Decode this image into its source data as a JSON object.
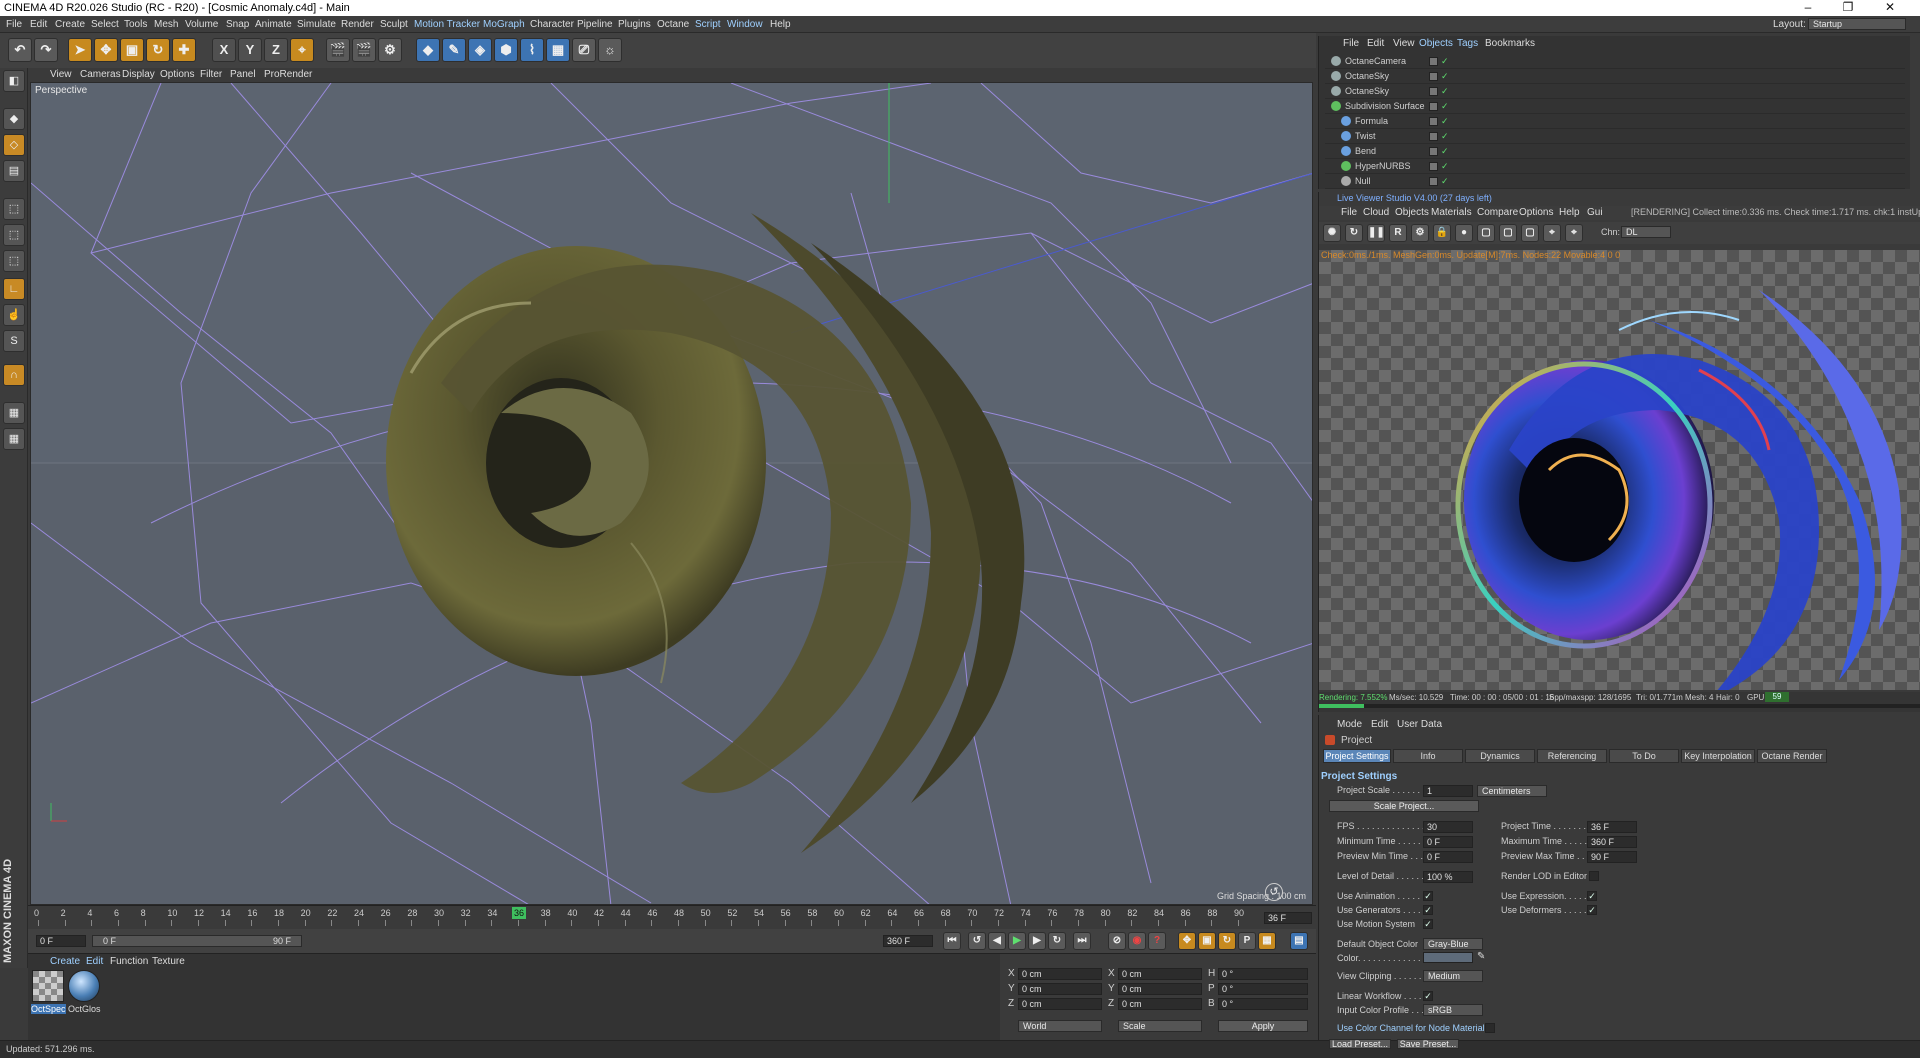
{
  "window": {
    "title": "CINEMA 4D R20.026 Studio (RC - R20) - [Cosmic Anomaly.c4d] - Main",
    "minimize": "–",
    "maximize": "❐",
    "close": "✕"
  },
  "menu": {
    "items": [
      "File",
      "Edit",
      "Create",
      "Select",
      "Tools",
      "Mesh",
      "Volume",
      "Snap",
      "Animate",
      "Simulate",
      "Render",
      "Sculpt",
      "Motion Tracker",
      "MoGraph",
      "Character",
      "Pipeline",
      "Plugins",
      "Octane",
      "Script",
      "Window",
      "Help"
    ],
    "layout_label": "Layout:",
    "layout_value": "Startup"
  },
  "toolbar": {
    "axis_x": "X",
    "axis_y": "Y",
    "axis_z": "Z"
  },
  "viewport": {
    "menu": [
      "View",
      "Cameras",
      "Display",
      "Options",
      "Filter",
      "Panel",
      "ProRender"
    ],
    "label": "Perspective",
    "grid_spacing": "Grid Spacing : 100 cm"
  },
  "timeline": {
    "ticks": [
      "0",
      "2",
      "4",
      "6",
      "8",
      "10",
      "12",
      "14",
      "16",
      "18",
      "20",
      "22",
      "24",
      "26",
      "28",
      "30",
      "32",
      "34",
      "36",
      "38",
      "40",
      "42",
      "44",
      "46",
      "48",
      "50",
      "52",
      "54",
      "56",
      "58",
      "60",
      "62",
      "64",
      "66",
      "68",
      "70",
      "72",
      "74",
      "76",
      "78",
      "80",
      "82",
      "84",
      "86",
      "88",
      "90"
    ],
    "current_frame": "36",
    "end_field": "36 F"
  },
  "playbar": {
    "start": "0 F",
    "min": "0 F",
    "max": "90 F",
    "end": "360 F"
  },
  "materials": {
    "menu": [
      "Create",
      "Edit",
      "Function",
      "Texture"
    ],
    "items": [
      "OctSpec",
      "OctGlos"
    ]
  },
  "coords": {
    "rows": [
      {
        "a": "X",
        "av": "0 cm",
        "b": "X",
        "bv": "0 cm",
        "c": "H",
        "cv": "0 °"
      },
      {
        "a": "Y",
        "av": "0 cm",
        "b": "Y",
        "bv": "0 cm",
        "c": "P",
        "cv": "0 °"
      },
      {
        "a": "Z",
        "av": "0 cm",
        "b": "Z",
        "bv": "0 cm",
        "c": "B",
        "cv": "0 °"
      }
    ],
    "world": "World",
    "scale": "Scale",
    "apply": "Apply"
  },
  "status": {
    "text": "Updated: 571.296 ms."
  },
  "objects": {
    "menu": [
      "File",
      "Edit",
      "View",
      "Objects",
      "Tags",
      "Bookmarks"
    ],
    "rows": [
      {
        "name": "OctaneCamera",
        "indent": 0,
        "color": "#9aa"
      },
      {
        "name": "OctaneSky",
        "indent": 0,
        "color": "#9aa"
      },
      {
        "name": "OctaneSky",
        "indent": 0,
        "color": "#9aa"
      },
      {
        "name": "Subdivision Surface",
        "indent": 0,
        "color": "#5fbf5f"
      },
      {
        "name": "Formula",
        "indent": 1,
        "color": "#6aa0e0"
      },
      {
        "name": "Twist",
        "indent": 1,
        "color": "#6aa0e0"
      },
      {
        "name": "Bend",
        "indent": 1,
        "color": "#6aa0e0"
      },
      {
        "name": "HyperNURBS",
        "indent": 1,
        "color": "#5fbf5f"
      },
      {
        "name": "Null",
        "indent": 1,
        "color": "#aaa"
      }
    ]
  },
  "liveviewer": {
    "title": "Live Viewer Studio V4.00 (27 days left)",
    "menu": [
      "File",
      "Cloud",
      "Objects",
      "Materials",
      "Compare",
      "Options",
      "Help",
      "Gui"
    ],
    "render_status": "[RENDERING] Collect time:0.336 ms.  Check time:1.717 ms.  chk:1  instUpd:0",
    "chn_label": "Chn:",
    "chn_value": "DL",
    "info": "Check:0ms./1ms. MeshGen:0ms. Update[M]:7ms. Nodes:22 Movable:4 0 0",
    "footer": {
      "rendering": "Rendering: 7.552%",
      "mssec": "Ms/sec: 10.529",
      "time": "Time: 00 : 00 : 05/00 : 01 : 16",
      "spp": "Spp/maxspp: 128/1695",
      "tri": "Tri: 0/1.771m",
      "mesh": "Mesh: 4",
      "hair": "Hair: 0",
      "gpu": "GPU:",
      "gpu_val": "59"
    },
    "progress": 0.0755
  },
  "attributes": {
    "menu": [
      "Mode",
      "Edit",
      "User Data"
    ],
    "object": "Project",
    "tabs": [
      "Project Settings",
      "Info",
      "Dynamics",
      "Referencing",
      "To Do",
      "Key Interpolation",
      "Octane Render"
    ],
    "section": "Project Settings",
    "project_scale_label": "Project Scale . . . . . .",
    "project_scale_value": "1",
    "project_scale_unit": "Centimeters",
    "scale_project_btn": "Scale Project...",
    "fps_label": "FPS . . . . . . . . . . . . . . .",
    "fps": "30",
    "project_time_label": "Project Time . . . . . . .",
    "project_time": "36 F",
    "min_time_label": "Minimum Time . . . . . .",
    "min_time": "0 F",
    "max_time_label": "Maximum Time . . . . . .",
    "max_time": "360 F",
    "prev_min_label": "Preview Min Time . . . .",
    "prev_min": "0 F",
    "prev_max_label": "Preview Max Time . . .",
    "prev_max": "90 F",
    "lod_label": "Level of Detail . . . . . .",
    "lod": "100 %",
    "render_lod_label": "Render LOD in Editor",
    "use_anim_label": "Use Animation . . . . . .",
    "use_expr_label": "Use Expression. . . . . .",
    "use_gen_label": "Use Generators . . . . .",
    "use_def_label": "Use Deformers . . . . . .",
    "use_motion_label": "Use Motion System",
    "def_color_label": "Default Object Color",
    "def_color": "Gray-Blue",
    "color_label": "Color. . . . . . . . . . . . . .",
    "view_clip_label": "View Clipping . . . . . .",
    "view_clip": "Medium",
    "linear_label": "Linear Workflow . . . . .",
    "input_profile_label": "Input Color Profile . . .",
    "input_profile": "sRGB",
    "node_color_label": "Use Color Channel for Node Material",
    "load_preset": "Load Preset...",
    "save_preset": "Save Preset...",
    "check": "✓"
  }
}
